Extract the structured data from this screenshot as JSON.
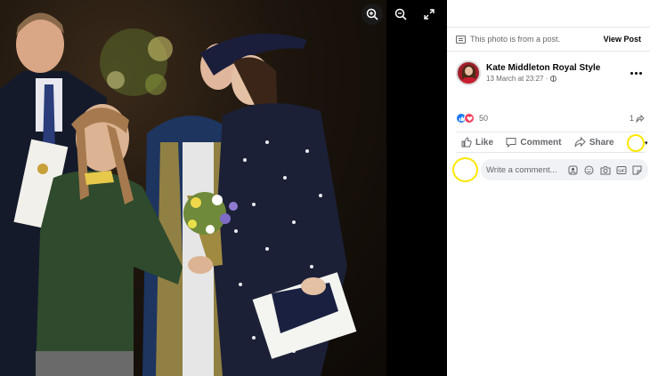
{
  "viewer": {
    "icons": [
      "zoom-in-icon",
      "zoom-out-icon",
      "fullscreen-icon"
    ]
  },
  "notice": {
    "text": "This photo is from a post.",
    "view_post": "View Post"
  },
  "post": {
    "page_name": "Kate Middleton Royal Style",
    "timestamp": "13 March at 23:27 ·",
    "reaction_count": "50",
    "share_count": "1"
  },
  "actions": {
    "like": "Like",
    "comment": "Comment",
    "share": "Share"
  },
  "comment": {
    "placeholder": "Write a comment..."
  },
  "colors": {
    "accent": "#1877f2",
    "love": "#f33e58",
    "highlight": "#ffe600"
  }
}
